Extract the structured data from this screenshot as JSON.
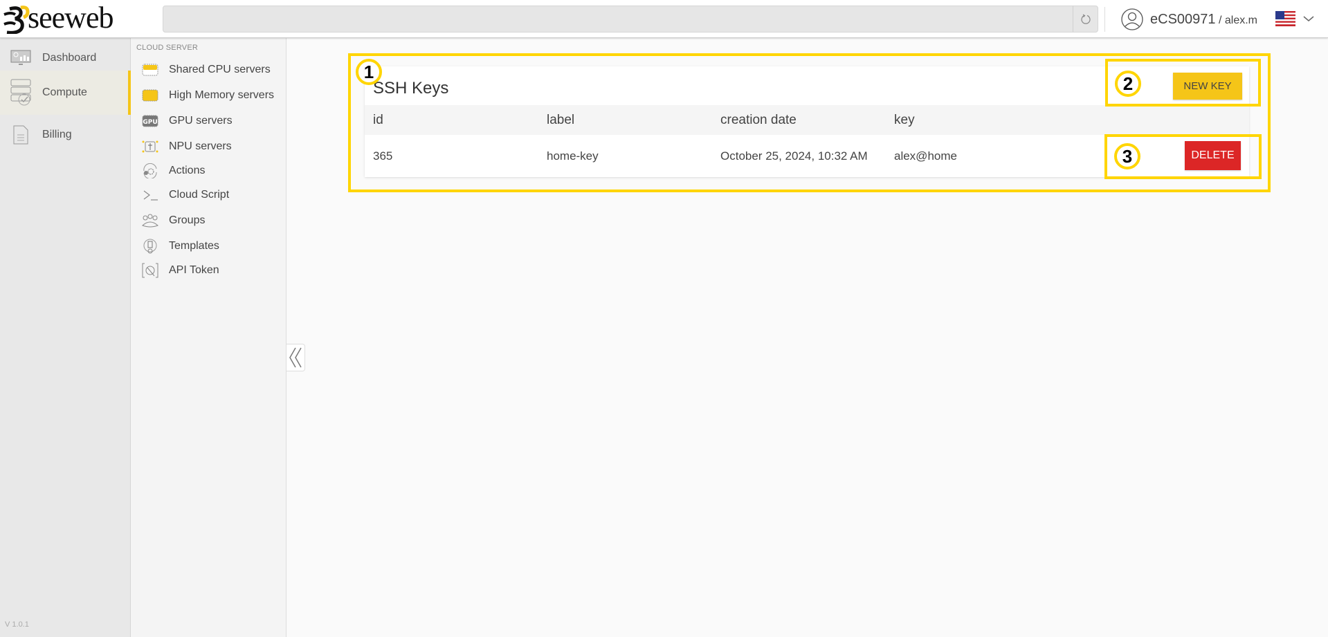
{
  "brand": {
    "name": "seeweb",
    "accent": "#f5c518"
  },
  "topbar": {
    "search_value": "",
    "refresh_icon": "refresh-icon",
    "account_id": "eCS00971",
    "username": " / alex.m",
    "language_flag": "us-flag-icon"
  },
  "rail": {
    "items": [
      {
        "label": "Dashboard",
        "icon": "dashboard-icon",
        "active": false
      },
      {
        "label": "Compute",
        "icon": "compute-icon",
        "active": true
      },
      {
        "label": "Billing",
        "icon": "billing-icon",
        "active": false
      }
    ],
    "version": "V 1.0.1"
  },
  "subnav": {
    "heading": "CLOUD SERVER",
    "items": [
      {
        "label": "Shared CPU servers",
        "icon": "shared-cpu-icon"
      },
      {
        "label": "High Memory servers",
        "icon": "high-memory-icon"
      },
      {
        "label": "GPU servers",
        "icon": "gpu-icon"
      },
      {
        "label": "NPU servers",
        "icon": "npu-icon"
      },
      {
        "label": "Actions",
        "icon": "actions-icon"
      },
      {
        "label": "Cloud Script",
        "icon": "terminal-icon"
      },
      {
        "label": "Groups",
        "icon": "groups-icon"
      },
      {
        "label": "Templates",
        "icon": "templates-icon"
      },
      {
        "label": "API Token",
        "icon": "api-token-icon"
      }
    ]
  },
  "main": {
    "title": "SSH Keys",
    "new_button": "NEW KEY",
    "columns": [
      "id",
      "label",
      "creation date",
      "key"
    ],
    "rows": [
      {
        "id": "365",
        "label": "home-key",
        "creation_date": "October 25, 2024, 10:32 AM",
        "key": "alex@home",
        "action": "DELETE"
      }
    ]
  },
  "annotations": [
    "1",
    "2",
    "3"
  ],
  "colors": {
    "accent_yellow": "#f5c518",
    "delete_red": "#dc2626",
    "annotation_yellow": "#ffd500"
  }
}
